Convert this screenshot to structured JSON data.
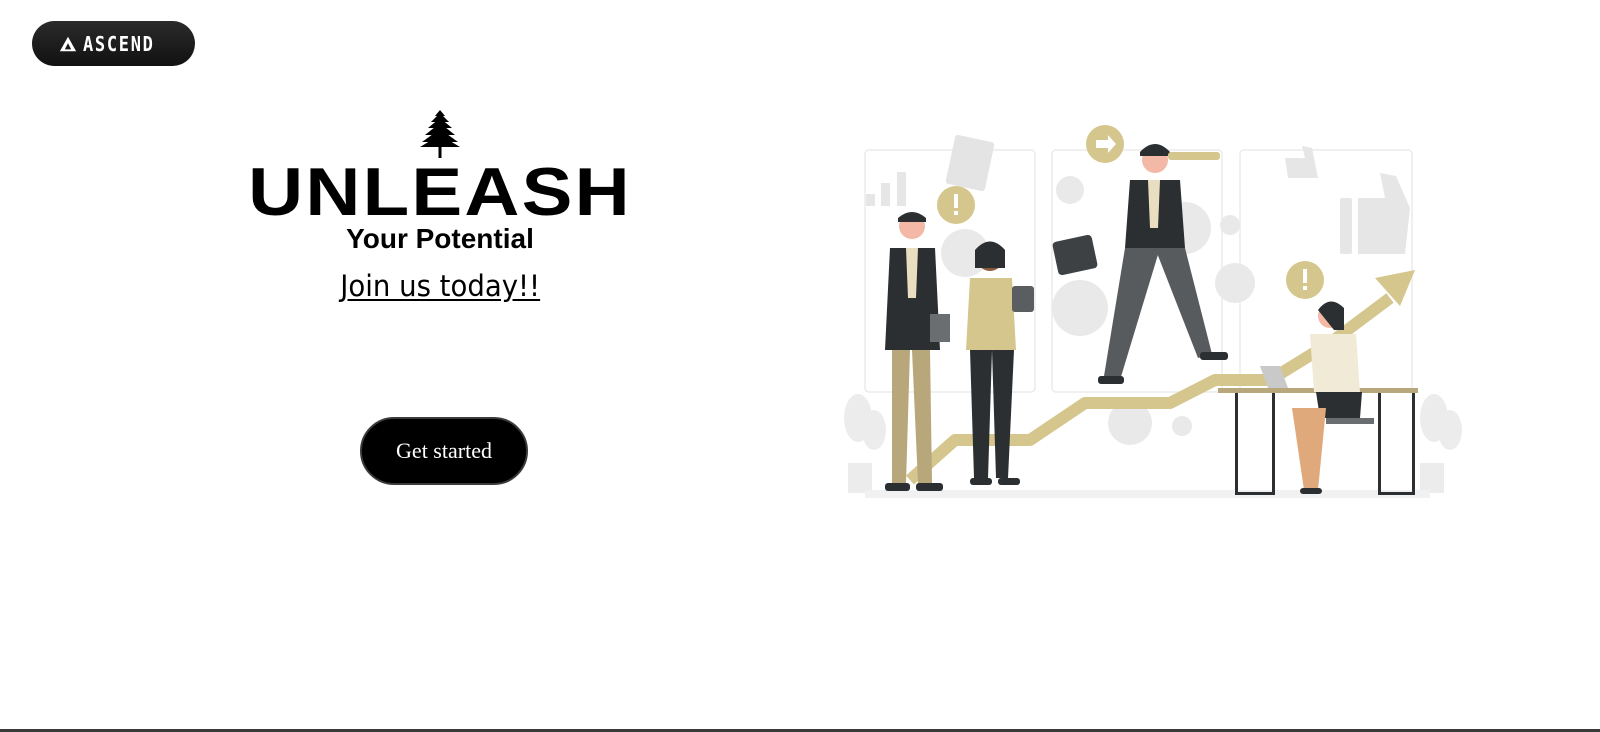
{
  "brand": {
    "logo_text": "ASCEND",
    "pill_color": "#1a1a1a"
  },
  "hero": {
    "headline": "UNLEASH",
    "subheadline": "Your Potential",
    "cta_text": "Join us today!!",
    "tree_icon": "pine-tree-icon"
  },
  "actions": {
    "get_started_label": "Get started"
  },
  "illustration": {
    "name": "team-growth-illustration",
    "accent_color": "#d4c68c",
    "dark_color": "#2b2f31"
  }
}
